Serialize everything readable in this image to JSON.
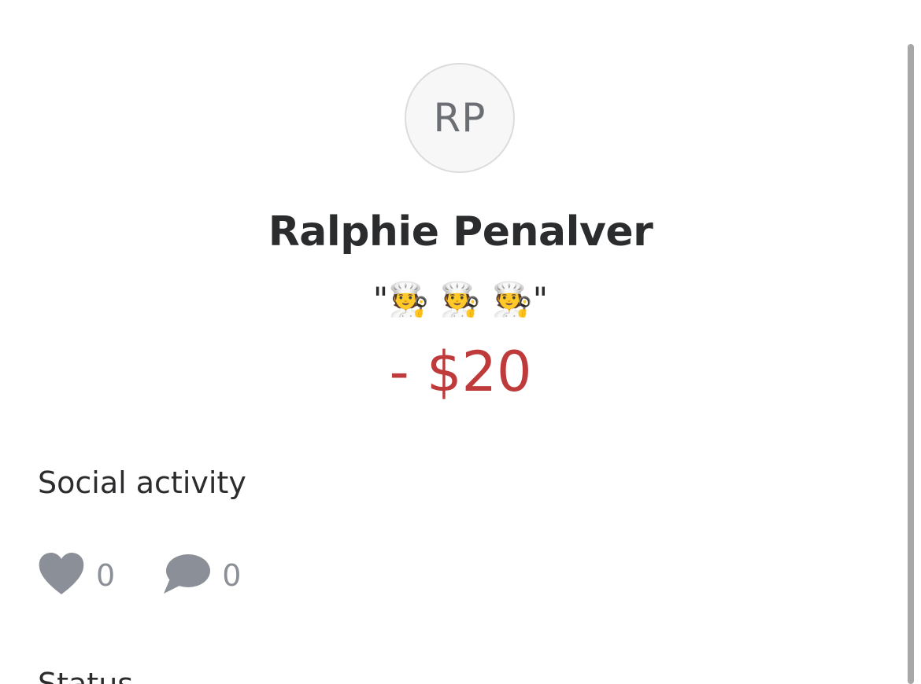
{
  "profile": {
    "initials": "RP",
    "name": "Ralphie Penalver",
    "note": "\"🧑‍🍳 🧑‍🍳 🧑‍🍳\"",
    "amount": "- $20"
  },
  "social": {
    "section_label": "Social activity",
    "likes_count": "0",
    "comments_count": "0",
    "likes_icon": "heart-icon",
    "comments_icon": "comment-bubble-icon"
  },
  "next_section": {
    "label": "Status"
  },
  "colors": {
    "amount": "#bf3a3a",
    "icon": "#8b8f97",
    "text": "#2b2c2e"
  }
}
